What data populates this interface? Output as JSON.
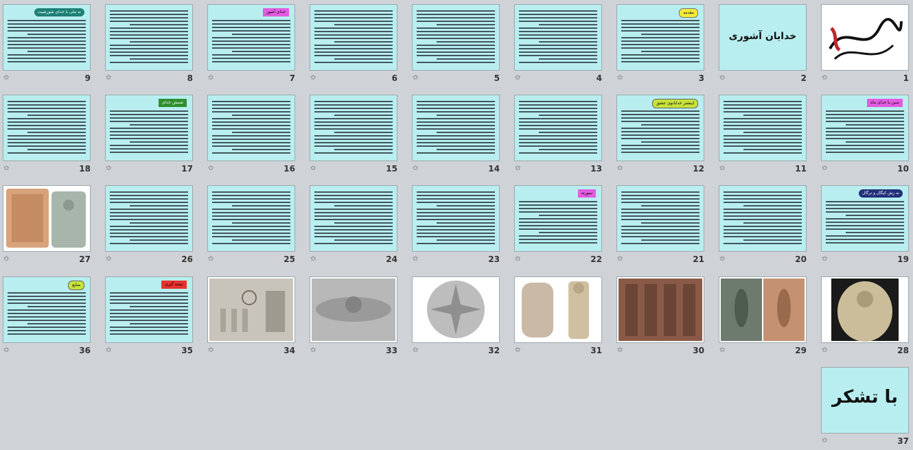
{
  "slides": [
    {
      "num": "1",
      "kind": "calligraphy"
    },
    {
      "num": "2",
      "kind": "title",
      "title": "خدایان آشوری"
    },
    {
      "num": "3",
      "kind": "text",
      "badge": "مقدمه",
      "badge_color": "yellow"
    },
    {
      "num": "4",
      "kind": "text"
    },
    {
      "num": "5",
      "kind": "text"
    },
    {
      "num": "6",
      "kind": "text"
    },
    {
      "num": "7",
      "kind": "text",
      "badge": "خدای آشور",
      "badge_color": "magenta"
    },
    {
      "num": "8",
      "kind": "text"
    },
    {
      "num": "9",
      "kind": "text",
      "badge": "نه ملی با خدای شورشیت",
      "badge_color": "teal"
    },
    {
      "num": "10",
      "kind": "text",
      "badge": "سین یا خدای ماه",
      "badge_color": "magenta"
    },
    {
      "num": "11",
      "kind": "text"
    },
    {
      "num": "12",
      "kind": "text",
      "badge": "اینشتر خدابانوی عشق",
      "badge_color": "lime"
    },
    {
      "num": "13",
      "kind": "text"
    },
    {
      "num": "14",
      "kind": "text"
    },
    {
      "num": "15",
      "kind": "text"
    },
    {
      "num": "16",
      "kind": "text"
    },
    {
      "num": "17",
      "kind": "text",
      "badge": "شمش خدای",
      "badge_color": "green"
    },
    {
      "num": "18",
      "kind": "text"
    },
    {
      "num": "19",
      "kind": "text",
      "badge": "نه رش کیگال و نرگال",
      "badge_color": "navy"
    },
    {
      "num": "20",
      "kind": "text"
    },
    {
      "num": "21",
      "kind": "text"
    },
    {
      "num": "22",
      "kind": "text",
      "badge": "نینورته",
      "badge_color": "magenta"
    },
    {
      "num": "23",
      "kind": "text"
    },
    {
      "num": "24",
      "kind": "text"
    },
    {
      "num": "25",
      "kind": "text"
    },
    {
      "num": "26",
      "kind": "text"
    },
    {
      "num": "27",
      "kind": "image",
      "image": "stele-relief-icon"
    },
    {
      "num": "28",
      "kind": "image",
      "image": "god-relief-icon"
    },
    {
      "num": "29",
      "kind": "image",
      "image": "ishtar-relief-icon"
    },
    {
      "num": "30",
      "kind": "image",
      "image": "brick-wall-relief-icon"
    },
    {
      "num": "31",
      "kind": "image",
      "image": "statue-stele-icon"
    },
    {
      "num": "32",
      "kind": "image",
      "image": "star-disc-icon"
    },
    {
      "num": "33",
      "kind": "image",
      "image": "winged-disc-icon"
    },
    {
      "num": "34",
      "kind": "image",
      "image": "throne-relief-icon"
    },
    {
      "num": "35",
      "kind": "text",
      "badge": "نتیجه گیری",
      "badge_color": "red"
    },
    {
      "num": "36",
      "kind": "text",
      "badge": "منابع",
      "badge_color": "lime"
    },
    {
      "num": "37",
      "kind": "thanks",
      "title": "با تشکر"
    }
  ],
  "colors": {
    "slide_bg": "#b8eef0",
    "page_bg": "#cfd2d6"
  }
}
